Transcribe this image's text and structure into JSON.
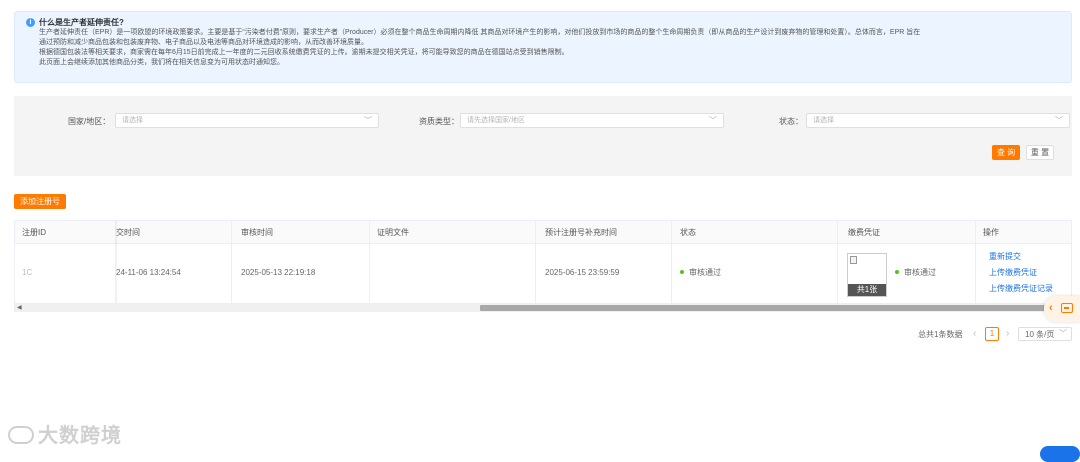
{
  "notice": {
    "icon": "info-icon",
    "title": "什么是生产者延伸责任?",
    "lines": [
      "生产者延伸责任（EPR）是一项欧盟的环境政策要求。主要是基于“污染者付费”原则，要求生产者（Producer）必须在整个商品生命周期内降低 其商品对环境产生的影响，对他们投放到市场的商品的整个生命周期负责（即从商品的生产设计到废弃物的管理和处置）。总体而言，EPR 旨在",
      "通过预防和减少商品包装和包装废弃物、电子商品以及电池等商品对环境造成的影响，从而改善环境质量。",
      "根据德国包装法等相关要求，商家需在每年6月15日前完成上一年度的二元回收系统缴费凭证的上传。逾期未提交相关凭证，将可能导致您的商品在德国站点受到销售限制。",
      "此页面上会继续添加其他商品分类，我们将在相关信息变为可用状态时通知您。"
    ]
  },
  "filter": {
    "country_label": "国家/地区：",
    "country_placeholder": "请选择",
    "resource_label": "资质类型：",
    "resource_placeholder": "请先选择国家/地区",
    "status_label": "状态：",
    "status_placeholder": "请选择",
    "query_label": "查 询",
    "reset_label": "重 置"
  },
  "add_button_label": "添加注册号",
  "table": {
    "headers": {
      "reg_id": "注册ID",
      "submit_time": "交时间",
      "review_time": "审核时间",
      "proof_file": "证明文件",
      "expected_time": "预计注册号补充时间",
      "status": "状态",
      "payment_voucher": "缴费凭证",
      "actions": "操作"
    },
    "rows": [
      {
        "reg_id": "1C",
        "submit_time": "24-11-06 13:24:54",
        "review_time": "2025-05-13 22:19:18",
        "proof_file": "",
        "expected_time": "2025-06-15 23:59:59",
        "status": "审核通过",
        "voucher_count": "共1张",
        "voucher_status": "审核通过",
        "actions": [
          "重新提交",
          "上传缴费凭证",
          "上传缴费凭证记录"
        ]
      }
    ]
  },
  "pagination": {
    "total_text": "总共1条数据",
    "current_page": "1",
    "page_size": "10 条/页"
  },
  "watermark_text": "大数跨境",
  "colors": {
    "accent": "#ff7a00",
    "link": "#1a73e8",
    "success": "#52c41a",
    "notice_bg": "#ecf5ff"
  }
}
